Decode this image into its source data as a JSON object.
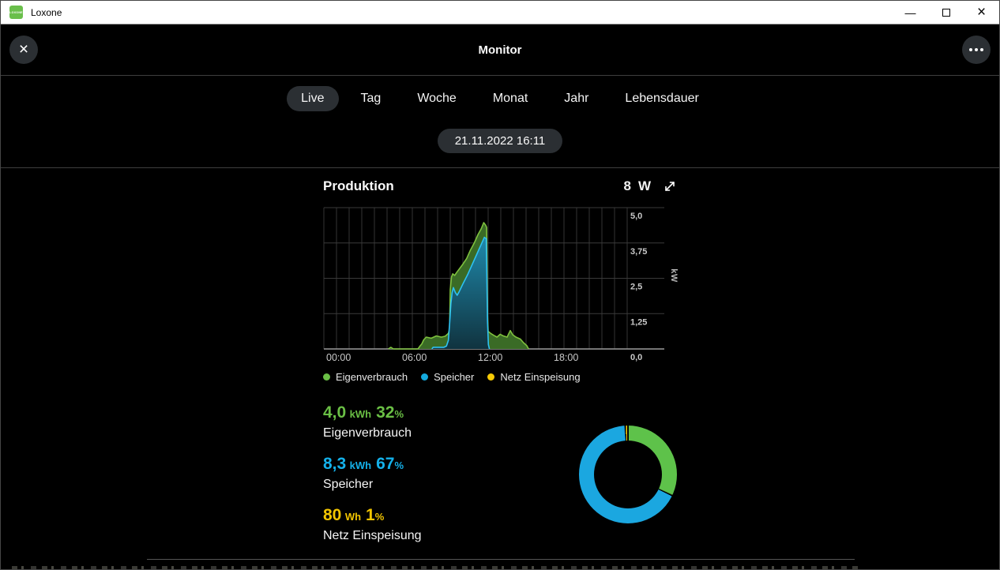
{
  "window": {
    "title": "Loxone",
    "logo_text": "LOXONE",
    "icons": {
      "minimize": "—",
      "close": "×"
    }
  },
  "header": {
    "title": "Monitor",
    "close_icon": "×",
    "more_icon": "more-options"
  },
  "tabs": {
    "active": "Live",
    "items": [
      {
        "label": "Live"
      },
      {
        "label": "Tag"
      },
      {
        "label": "Woche"
      },
      {
        "label": "Monat"
      },
      {
        "label": "Jahr"
      },
      {
        "label": "Lebensdauer"
      }
    ]
  },
  "datetime_pill": "21.11.2022 16:11",
  "monitor_card": {
    "title": "Produktion",
    "current_value": "8",
    "current_unit": "W",
    "legend": [
      {
        "label": "Eigenverbrauch",
        "color": "#6abf45"
      },
      {
        "label": "Speicher",
        "color": "#14aadf"
      },
      {
        "label": "Netz Einspeisung",
        "color": "#f7cb05"
      }
    ],
    "stats": [
      {
        "value": "4,0",
        "unit": "kWh",
        "percent": "32",
        "percent_unit": "%",
        "label": "Eigenverbrauch",
        "color": "#6abf45"
      },
      {
        "value": "8,3",
        "unit": "kWh",
        "percent": "67",
        "percent_unit": "%",
        "label": "Speicher",
        "color": "#14b1ea"
      },
      {
        "value": "80",
        "unit": "Wh",
        "percent": "1",
        "percent_unit": "%",
        "label": "Netz Einspeisung",
        "color": "#f2c500"
      }
    ]
  },
  "chart_data": [
    {
      "type": "area",
      "title": "Produktion",
      "ylabel": "kW",
      "ylim": [
        0,
        5
      ],
      "yticks": [
        {
          "value": 0,
          "label": "0,0"
        },
        {
          "value": 1.25,
          "label": "1,25"
        },
        {
          "value": 2.5,
          "label": "2,5"
        },
        {
          "value": 3.75,
          "label": "3,75"
        },
        {
          "value": 5,
          "label": "5,0"
        }
      ],
      "x_unit": "hours",
      "xlim": [
        0,
        24
      ],
      "x_grid_interval": 1,
      "xticks": [
        {
          "value": 0,
          "label": "00:00"
        },
        {
          "value": 6,
          "label": "06:00"
        },
        {
          "value": 12,
          "label": "12:00"
        },
        {
          "value": 18,
          "label": "18:00"
        }
      ],
      "grid": true,
      "series": [
        {
          "name": "Eigenverbrauch",
          "line_color": "#7fc13e",
          "fill_color": "#3a6b26",
          "points": [
            [
              0,
              0
            ],
            [
              5.1,
              0
            ],
            [
              5.3,
              0.06
            ],
            [
              5.5,
              0
            ],
            [
              7.45,
              0
            ],
            [
              7.6,
              0.1
            ],
            [
              7.75,
              0.18
            ],
            [
              7.9,
              0.32
            ],
            [
              8.1,
              0.42
            ],
            [
              8.5,
              0.38
            ],
            [
              8.9,
              0.46
            ],
            [
              9.3,
              0.42
            ],
            [
              9.6,
              0.45
            ],
            [
              9.85,
              0.55
            ],
            [
              9.95,
              0.7
            ],
            [
              10.0,
              2.1
            ],
            [
              10.1,
              2.55
            ],
            [
              10.2,
              2.66
            ],
            [
              10.35,
              2.6
            ],
            [
              10.5,
              2.7
            ],
            [
              10.75,
              2.85
            ],
            [
              11.0,
              3.0
            ],
            [
              11.3,
              3.2
            ],
            [
              11.6,
              3.5
            ],
            [
              11.9,
              3.75
            ],
            [
              12.2,
              4.05
            ],
            [
              12.45,
              4.25
            ],
            [
              12.65,
              4.47
            ],
            [
              12.8,
              4.38
            ],
            [
              12.88,
              4.3
            ],
            [
              12.95,
              1.2
            ],
            [
              13.0,
              0.62
            ],
            [
              13.2,
              0.55
            ],
            [
              13.45,
              0.48
            ],
            [
              13.7,
              0.42
            ],
            [
              13.95,
              0.52
            ],
            [
              14.2,
              0.46
            ],
            [
              14.5,
              0.42
            ],
            [
              14.75,
              0.65
            ],
            [
              14.95,
              0.5
            ],
            [
              15.2,
              0.42
            ],
            [
              15.55,
              0.35
            ],
            [
              15.8,
              0.22
            ],
            [
              16.05,
              0.12
            ],
            [
              16.2,
              0
            ]
          ]
        },
        {
          "name": "Speicher",
          "line_color": "#2ec2f2",
          "fill_gradient_top": "#1f89ab",
          "fill_gradient_bottom": "#10333f",
          "points": [
            [
              0,
              0
            ],
            [
              8.55,
              0
            ],
            [
              8.65,
              0.06
            ],
            [
              9.5,
              0.06
            ],
            [
              9.7,
              0.1
            ],
            [
              9.85,
              0.3
            ],
            [
              9.95,
              0.9
            ],
            [
              10.05,
              1.6
            ],
            [
              10.15,
              2.0
            ],
            [
              10.25,
              2.17
            ],
            [
              10.4,
              2.0
            ],
            [
              10.55,
              1.9
            ],
            [
              10.7,
              2.02
            ],
            [
              11.0,
              2.3
            ],
            [
              11.4,
              2.65
            ],
            [
              11.8,
              3.05
            ],
            [
              12.2,
              3.45
            ],
            [
              12.5,
              3.75
            ],
            [
              12.7,
              3.95
            ],
            [
              12.85,
              3.9
            ],
            [
              12.95,
              1.0
            ],
            [
              13.02,
              0.15
            ],
            [
              13.1,
              0
            ],
            [
              24,
              0
            ]
          ]
        }
      ],
      "legend_note": "Netz Einspeisung series has no visible area in this window"
    },
    {
      "type": "pie",
      "donut": true,
      "start_angle_deg": 0,
      "direction": "clockwise",
      "slices": [
        {
          "label": "Eigenverbrauch",
          "percent": 32,
          "color": "#5ec24a"
        },
        {
          "label": "Speicher",
          "percent": 67,
          "color": "#1ba7e0"
        },
        {
          "label": "Netz Einspeisung",
          "percent": 1,
          "color": "#ffd105"
        }
      ]
    }
  ]
}
